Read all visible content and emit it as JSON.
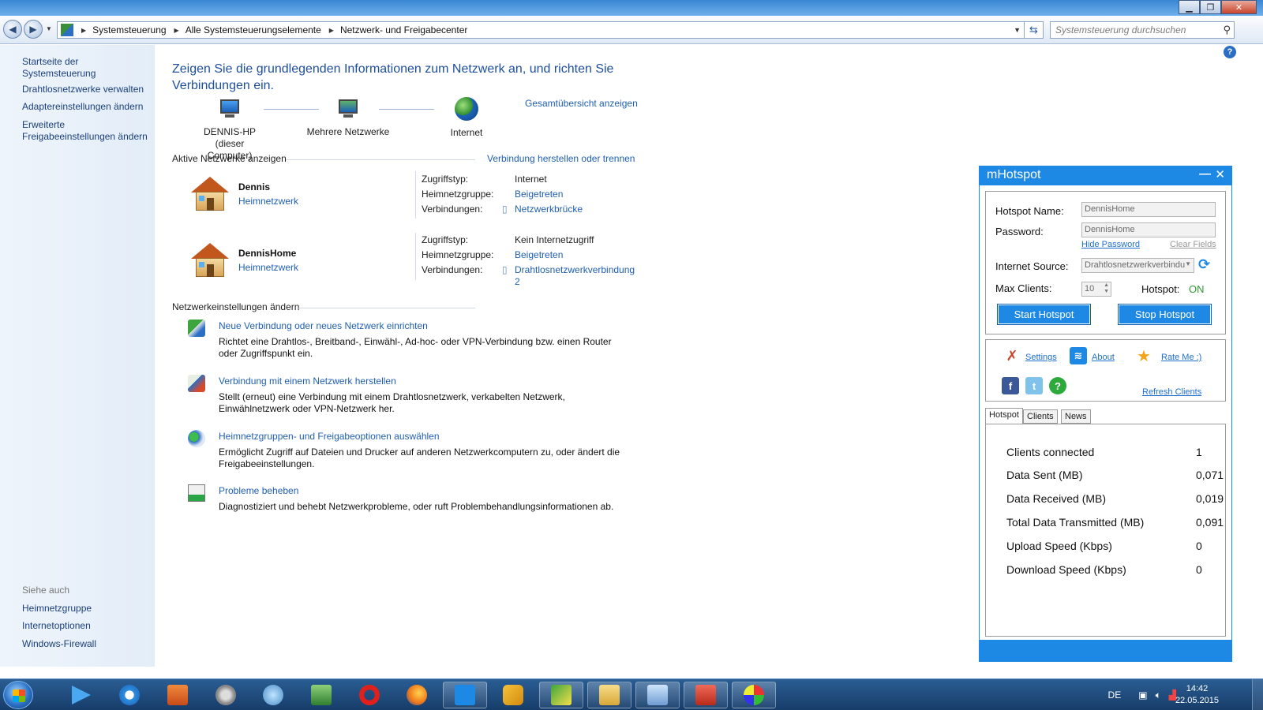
{
  "address": {
    "crumbs": [
      "Systemsteuerung",
      "Alle Systemsteuerungselemente",
      "Netzwerk- und Freigabecenter"
    ],
    "search_placeholder": "Systemsteuerung durchsuchen"
  },
  "leftnav": {
    "home": "Startseite der Systemsteuerung",
    "items": [
      "Drahtlosnetzwerke verwalten",
      "Adaptereinstellungen ändern",
      "Erweiterte Freigabeeinstellungen ändern"
    ],
    "see_also_title": "Siehe auch",
    "see_also": [
      "Heimnetzgruppe",
      "Internetoptionen",
      "Windows-Firewall"
    ]
  },
  "main": {
    "headline": "Zeigen Sie die grundlegenden Informationen zum Netzwerk an, und richten Sie Verbindungen ein.",
    "map": {
      "computer_name": "DENNIS-HP",
      "computer_sub": "(dieser Computer)",
      "middle": "Mehrere Netzwerke",
      "internet": "Internet",
      "full_map_link": "Gesamtübersicht anzeigen"
    },
    "active_title": "Aktive Netzwerke anzeigen",
    "connect_link": "Verbindung herstellen oder trennen",
    "labels": {
      "access": "Zugriffstyp:",
      "homegroup": "Heimnetzgruppe:",
      "connections": "Verbindungen:"
    },
    "networks": [
      {
        "name": "Dennis",
        "type": "Heimnetzwerk",
        "access": "Internet",
        "homegroup": "Beigetreten",
        "connection": "Netzwerkbrücke",
        "connection_line2": ""
      },
      {
        "name": "DennisHome",
        "type": "Heimnetzwerk",
        "access": "Kein Internetzugriff",
        "homegroup": "Beigetreten",
        "connection": "Drahtlosnetzwerkverbindung",
        "connection_line2": "2"
      }
    ],
    "settings_title": "Netzwerkeinstellungen ändern",
    "tasks": [
      {
        "title": "Neue Verbindung oder neues Netzwerk einrichten",
        "desc": "Richtet eine Drahtlos-, Breitband-, Einwähl-, Ad-hoc- oder VPN-Verbindung bzw. einen Router oder Zugriffspunkt ein."
      },
      {
        "title": "Verbindung mit einem Netzwerk herstellen",
        "desc": "Stellt (erneut) eine Verbindung mit einem Drahtlosnetzwerk, verkabelten Netzwerk, Einwählnetzwerk oder VPN-Netzwerk her."
      },
      {
        "title": "Heimnetzgruppen- und Freigabeoptionen auswählen",
        "desc": "Ermöglicht Zugriff auf Dateien und Drucker auf anderen Netzwerkcomputern zu, oder ändert die Freigabeeinstellungen."
      },
      {
        "title": "Probleme beheben",
        "desc": "Diagnostiziert und behebt Netzwerkprobleme, oder ruft Problembehandlungsinformationen ab."
      }
    ]
  },
  "mhotspot": {
    "title": "mHotspot",
    "hotspot_name_label": "Hotspot Name:",
    "hotspot_name_value": "DennisHome",
    "password_label": "Password:",
    "password_value": "DennisHome",
    "hide_password": "Hide Password",
    "clear_fields": "Clear Fields",
    "internet_source_label": "Internet Source:",
    "internet_source_value": "Drahtlosnetzwerkverbindu",
    "max_clients_label": "Max Clients:",
    "max_clients_value": "10",
    "hotspot_label": "Hotspot:",
    "hotspot_state": "ON",
    "start_button": "Start Hotspot",
    "stop_button": "Stop Hotspot",
    "settings_link": "Settings",
    "about_link": "About",
    "rate_link": "Rate Me :)",
    "refresh_link": "Refresh Clients",
    "tabs": [
      "Hotspot",
      "Clients",
      "News"
    ],
    "stats": [
      {
        "label": "Clients connected",
        "value": "1"
      },
      {
        "label": "Data Sent (MB)",
        "value": "0,071"
      },
      {
        "label": "Data Received (MB)",
        "value": "0,019"
      },
      {
        "label": "Total Data Transmitted (MB)",
        "value": "0,091"
      },
      {
        "label": "Upload Speed (Kbps)",
        "value": "0"
      },
      {
        "label": "Download Speed (Kbps)",
        "value": "0"
      }
    ]
  },
  "taskbar": {
    "language": "DE",
    "time": "14:42",
    "date": "22.05.2015"
  },
  "colors": {
    "link": "#1f5fb0",
    "accent": "#1e88e5",
    "on_green": "#2e9b2e"
  }
}
